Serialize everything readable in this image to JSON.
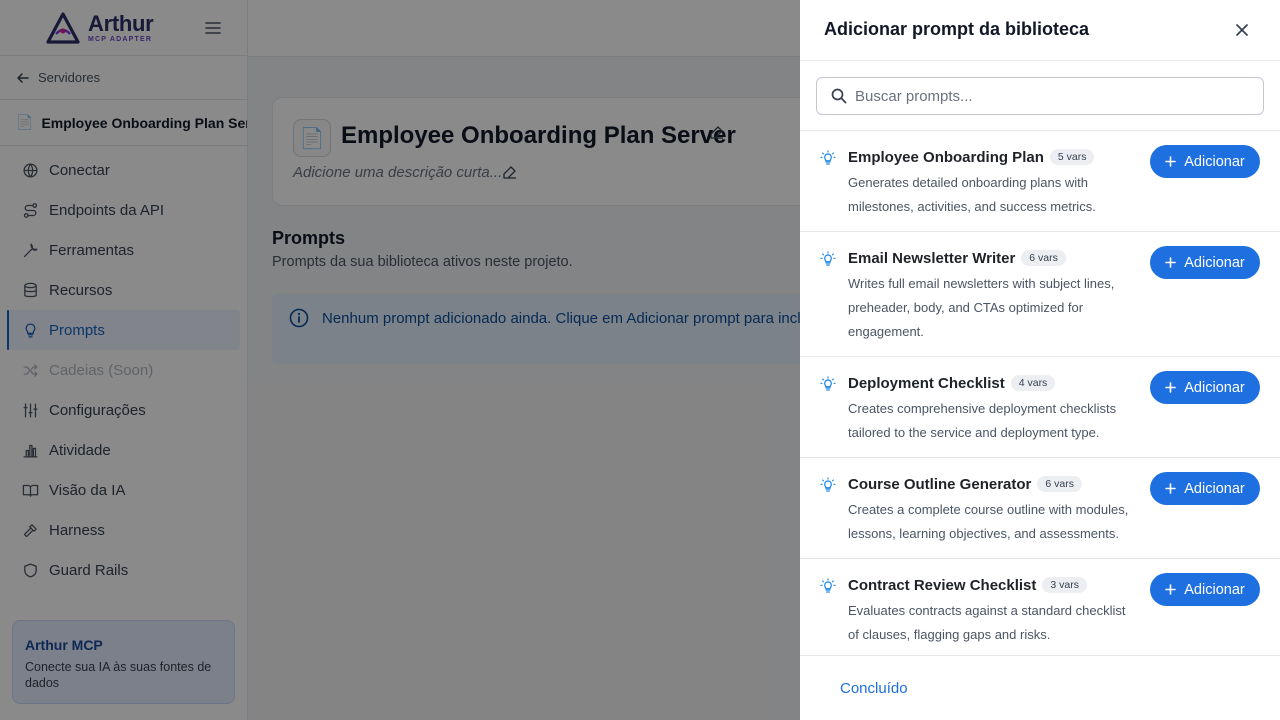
{
  "app": {
    "logo_name": "Arthur",
    "logo_subtitle": "MCP ADAPTER"
  },
  "sidebar": {
    "back_label": "Servidores",
    "server_name": "Employee Onboarding Plan Server",
    "items": [
      {
        "label": "Conectar",
        "icon": "globe-icon"
      },
      {
        "label": "Endpoints da API",
        "icon": "route-icon"
      },
      {
        "label": "Ferramentas",
        "icon": "wrench-icon"
      },
      {
        "label": "Recursos",
        "icon": "database-icon"
      },
      {
        "label": "Prompts",
        "icon": "lightbulb-icon",
        "active": true
      },
      {
        "label": "Cadeias (Soon)",
        "icon": "shuffle-icon",
        "disabled": true
      },
      {
        "label": "Configurações",
        "icon": "sliders-icon"
      },
      {
        "label": "Atividade",
        "icon": "bar-chart-icon"
      },
      {
        "label": "Visão da IA",
        "icon": "book-open-icon"
      },
      {
        "label": "Harness",
        "icon": "hammer-icon"
      },
      {
        "label": "Guard Rails",
        "icon": "shield-icon"
      }
    ],
    "promo": {
      "title": "Arthur MCP",
      "text": "Conecte sua IA às suas fontes de dados"
    }
  },
  "main": {
    "title": "Employee Onboarding Plan Server",
    "description_placeholder": "Adicione uma descrição curta...",
    "section_title": "Prompts",
    "section_subtitle": "Prompts da sua biblioteca ativos neste projeto.",
    "info_message": "Nenhum prompt adicionado ainda. Clique em Adicionar prompt para incluir novos."
  },
  "drawer": {
    "title": "Adicionar prompt da biblioteca",
    "search_placeholder": "Buscar prompts...",
    "add_label": "Adicionar",
    "done_label": "Concluído",
    "prompts": [
      {
        "name": "Employee Onboarding Plan",
        "vars": "5 vars",
        "description": "Generates detailed onboarding plans with milestones, activities, and success metrics."
      },
      {
        "name": "Email Newsletter Writer",
        "vars": "6 vars",
        "description": "Writes full email newsletters with subject lines, preheader, body, and CTAs optimized for engagement."
      },
      {
        "name": "Deployment Checklist",
        "vars": "4 vars",
        "description": "Creates comprehensive deployment checklists tailored to the service and deployment type."
      },
      {
        "name": "Course Outline Generator",
        "vars": "6 vars",
        "description": "Creates a complete course outline with modules, lessons, learning objectives, and assessments."
      },
      {
        "name": "Contract Review Checklist",
        "vars": "3 vars",
        "description": "Evaluates contracts against a standard checklist of clauses, flagging gaps and risks."
      }
    ]
  },
  "colors": {
    "accent": "#1e6fe0",
    "active_nav": "#1565c0",
    "info_bg": "#e6f1fd"
  }
}
